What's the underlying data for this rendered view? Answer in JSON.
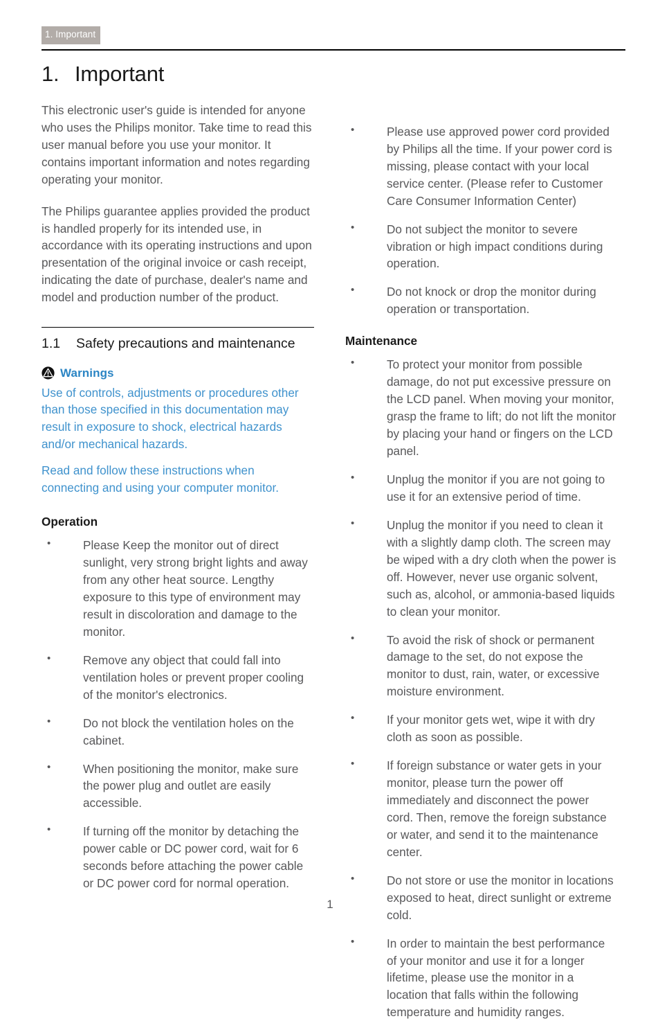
{
  "running_header": {
    "label": "1. Important",
    "background": "#b2aca8",
    "text_color": "#ffffff"
  },
  "chapter": {
    "number": "1.",
    "title": "Important"
  },
  "intro_paragraphs": [
    "This electronic user's guide is intended for anyone who uses the Philips monitor. Take time to read this user manual before you use your monitor. It contains important information and notes regarding operating your monitor.",
    "The Philips guarantee applies provided the product is handled properly for its intended use, in accordance with its operating instructions and upon presentation of the original invoice or cash receipt, indicating the date of purchase, dealer's name and model and production number of the product."
  ],
  "section": {
    "number": "1.1",
    "title": "Safety precautions and maintenance"
  },
  "warnings": {
    "icon": "warning-triangle-icon",
    "label": "Warnings",
    "color": "#3f92cd",
    "paragraphs": [
      "Use of controls, adjustments or procedures other than those specified in this documentation may result in exposure to shock, electrical hazards and/or mechanical hazards.",
      "Read and follow these instructions when connecting and using your computer monitor."
    ]
  },
  "operation": {
    "heading": "Operation",
    "bullets": [
      "Please Keep the monitor out of direct sunlight, very strong bright lights and away from any other heat source. Lengthy exposure to this type of environment may result in discoloration and damage to the monitor.",
      "Remove any object that could fall into ventilation holes or prevent proper cooling of the monitor's electronics.",
      "Do not block the ventilation holes on the cabinet.",
      "When positioning the monitor, make sure the power plug and outlet are easily accessible.",
      "If turning off the monitor by detaching the power cable or DC power cord, wait for 6 seconds before attaching the power cable or DC power cord for normal operation.",
      "Please use approved power cord provided by Philips all the time. If your power cord is missing, please contact with your local service center. (Please refer to Customer Care Consumer Information Center)",
      "Do not subject the monitor to severe vibration or high impact conditions during operation.",
      "Do not knock or drop the monitor during operation or transportation."
    ]
  },
  "maintenance": {
    "heading": "Maintenance",
    "bullets": [
      "To protect your monitor from possible damage, do not put excessive pressure on the LCD panel. When moving your monitor, grasp the frame to lift; do not lift the monitor by placing your hand or fingers on the LCD panel.",
      "Unplug the monitor if you are not going to use it for an extensive period of time.",
      "Unplug the monitor if you need to clean it with a slightly damp cloth. The screen may be wiped with a dry cloth when the power is off. However, never use organic solvent, such as, alcohol, or ammonia-based liquids to clean your monitor.",
      "To avoid the risk of shock or permanent damage to the set, do not expose the monitor to dust, rain, water, or excessive moisture environment.",
      "If your monitor gets wet, wipe it with dry cloth as soon as possible.",
      "If foreign substance or water gets in your monitor, please turn the power off immediately and disconnect the power cord. Then, remove the foreign substance or water, and send it to the maintenance center.",
      "Do not store or use the monitor in locations exposed to heat, direct sunlight or extreme cold.",
      "In order to maintain the best performance of your monitor and use it for a longer lifetime, please use the monitor in a location that falls within the following temperature and humidity ranges."
    ]
  },
  "footer": {
    "page_number": "1"
  }
}
